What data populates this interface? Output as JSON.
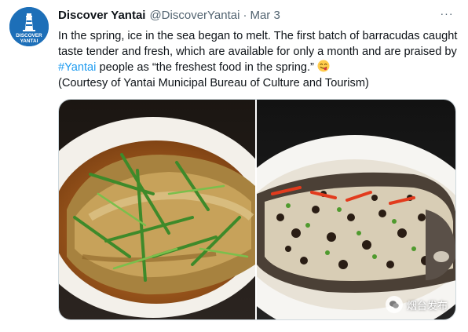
{
  "account": {
    "display_name": "Discover Yantai",
    "handle": "@DiscoverYantai",
    "separator": "·",
    "date": "Mar 3",
    "avatar_text_top": "DISCOVER",
    "avatar_text_bottom": "YANTAI",
    "avatar_color": "#1d6fb8"
  },
  "tweet": {
    "text_before_hashtag": "In the spring, ice in the sea began to melt. The first batch of barracudas caught taste tender and fresh, which are available for only a month and are praised by ",
    "hashtag": "#Yantai",
    "text_after_hashtag": " people as “the freshest food in the spring.”",
    "emoji": "face-savoring-food-emoji",
    "credit": "(Courtesy of Yantai Municipal Bureau of Culture and Tourism)"
  },
  "menu": {
    "more_label": "···"
  },
  "media": {
    "photos": [
      {
        "subject": "braised-fish-with-scallions"
      },
      {
        "subject": "steamed-fish-with-fermented-black-beans-and-chili"
      }
    ],
    "watermark": "烟台发布"
  },
  "colors": {
    "text": "#0f1419",
    "muted": "#536471",
    "link": "#1d9bf0",
    "border": "#cfd9de"
  }
}
